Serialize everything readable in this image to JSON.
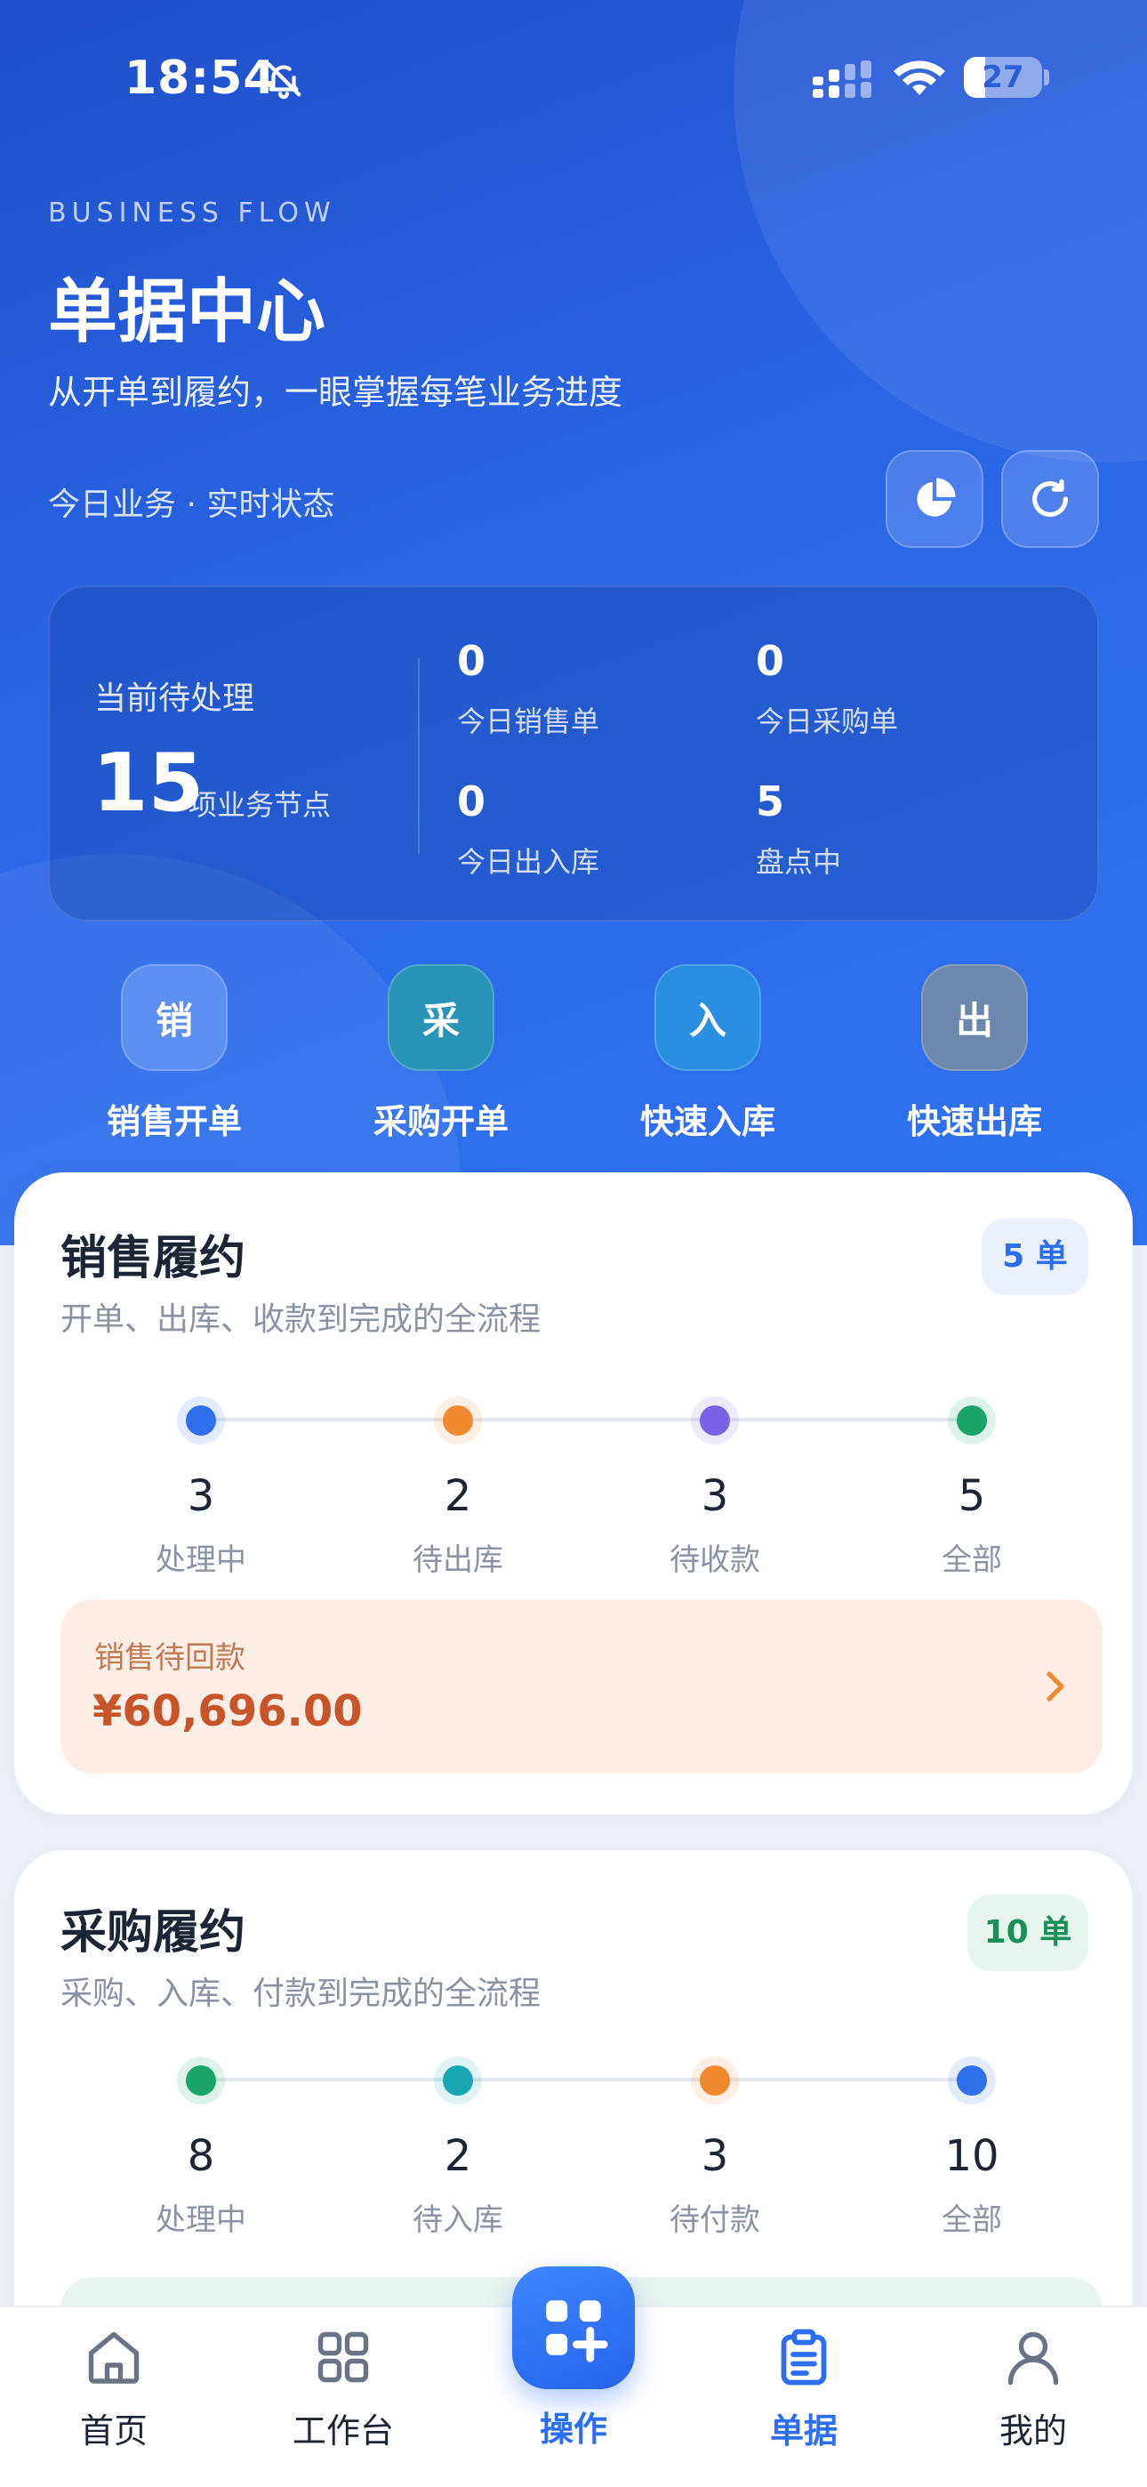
{
  "status_bar": {
    "time": "18:54",
    "battery": "27",
    "battery_level": 0.27
  },
  "header": {
    "eyebrow": "BUSINESS FLOW",
    "title": "单据中心",
    "subtitle": "从开单到履约，一眼掌握每笔业务进度",
    "today_label": "今日业务 · 实时状态",
    "chart_icon": "pie-chart-icon",
    "refresh_icon": "refresh-icon"
  },
  "summary": {
    "pending_label": "当前待处理",
    "pending_value": "15",
    "pending_unit": "项业务节点",
    "stats": [
      {
        "value": "0",
        "label": "今日销售单"
      },
      {
        "value": "0",
        "label": "今日采购单"
      },
      {
        "value": "0",
        "label": "今日出入库"
      },
      {
        "value": "5",
        "label": "盘点中"
      }
    ]
  },
  "quick_actions": [
    {
      "icon_char": "销",
      "label": "销售开单",
      "color": "#5b8ff0"
    },
    {
      "icon_char": "采",
      "label": "采购开单",
      "color": "#2a93b8"
    },
    {
      "icon_char": "入",
      "label": "快速入库",
      "color": "#2a8fe0"
    },
    {
      "icon_char": "出",
      "label": "快速出库",
      "color": "#6d87ad"
    }
  ],
  "sales": {
    "title": "销售履约",
    "subtitle": "开单、出库、收款到完成的全流程",
    "badge": "5 单",
    "badge_bg": "#eaf1fd",
    "badge_color": "#2b6ef2",
    "steps": [
      {
        "value": "3",
        "label": "处理中",
        "color": "#2f6fec"
      },
      {
        "value": "2",
        "label": "待出库",
        "color": "#f08a30"
      },
      {
        "value": "3",
        "label": "待收款",
        "color": "#7b61e8"
      },
      {
        "value": "5",
        "label": "全部",
        "color": "#1aa46a"
      }
    ],
    "receivable": {
      "label": "销售待回款",
      "amount": "¥60,696.00",
      "color": "#c8542a"
    }
  },
  "purchase": {
    "title": "采购履约",
    "subtitle": "采购、入库、付款到完成的全流程",
    "badge": "10 单",
    "badge_bg": "#e6f6ee",
    "badge_color": "#1a8f5a",
    "steps": [
      {
        "value": "8",
        "label": "处理中",
        "color": "#1aa46a"
      },
      {
        "value": "2",
        "label": "待入库",
        "color": "#16a7b3"
      },
      {
        "value": "3",
        "label": "待付款",
        "color": "#f08a30"
      },
      {
        "value": "10",
        "label": "全部",
        "color": "#2f6fec"
      }
    ]
  },
  "tabbar": {
    "items": [
      {
        "label": "首页",
        "icon": "home-icon"
      },
      {
        "label": "工作台",
        "icon": "grid-icon"
      },
      {
        "label": "操作",
        "icon": "apps-plus-icon"
      },
      {
        "label": "单据",
        "icon": "clipboard-icon"
      },
      {
        "label": "我的",
        "icon": "user-icon"
      }
    ],
    "active_color": "#2b6ef2"
  }
}
